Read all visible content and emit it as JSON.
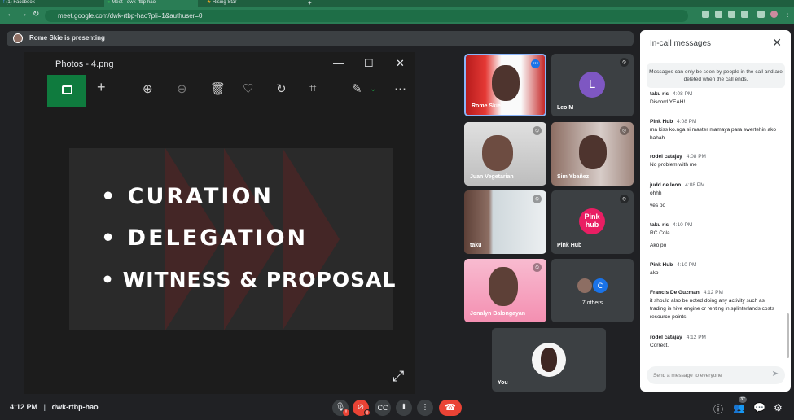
{
  "browser": {
    "tabs": [
      {
        "label": "(1) Facebook"
      },
      {
        "label": "Meet - dwk-rtbp-hao"
      },
      {
        "label": "Rising Star"
      }
    ],
    "url": "meet.google.com/dwk-rtbp-hao?pli=1&authuser=0"
  },
  "meeting": {
    "presenting_label": "Rome Skie is presenting",
    "time": "4:12 PM",
    "code": "dwk-rtbp-hao"
  },
  "photos": {
    "title": "Photos - 4.png",
    "slide_lines": [
      "• CURATION",
      "• DELEGATION",
      "• WITNESS & PROPOSAL"
    ]
  },
  "participants": [
    {
      "name": "Rome Skie",
      "muted": false
    },
    {
      "name": "Leo M",
      "initial": "L",
      "muted": true
    },
    {
      "name": "Juan Vegetarian",
      "muted": true
    },
    {
      "name": "Sim Ybañez",
      "muted": true
    },
    {
      "name": "taku",
      "muted": true
    },
    {
      "name": "Pink Hub",
      "logo_line1": "Pink",
      "logo_line2": "hub",
      "muted": true
    },
    {
      "name": "Jonalyn Balongayan",
      "muted": true
    },
    {
      "name": "7 others",
      "initial": "C"
    },
    {
      "name": "You"
    }
  ],
  "chat": {
    "title": "In-call messages",
    "notice": "Messages can only be seen by people in the call and are deleted when the call ends.",
    "messages": [
      {
        "sender": "taku ris",
        "time": "4:08 PM",
        "lines": [
          "Discord YEAH!"
        ]
      },
      {
        "sender": "Pink Hub",
        "time": "4:08 PM",
        "lines": [
          "ma kiss ko.nga si master mamaya para swertehin ako hahah"
        ]
      },
      {
        "sender": "rodel catajay",
        "time": "4:08 PM",
        "lines": [
          "No problem with me"
        ]
      },
      {
        "sender": "judd de leon",
        "time": "4:08 PM",
        "lines": [
          "ohhh",
          "yes po"
        ]
      },
      {
        "sender": "taku ris",
        "time": "4:10 PM",
        "lines": [
          "RC Cola",
          "Ako po"
        ]
      },
      {
        "sender": "Pink Hub",
        "time": "4:10 PM",
        "lines": [
          "ako"
        ]
      },
      {
        "sender": "Francis De Guzman",
        "time": "4:12 PM",
        "lines": [
          "it should also be noted doing any activity such as trading is hive engine or renting in splinterlands costs resource points."
        ]
      },
      {
        "sender": "rodel catajay",
        "time": "4:12 PM",
        "lines": [
          "Correct."
        ]
      }
    ],
    "input_placeholder": "Send a message to everyone"
  },
  "controls": {
    "participant_count": "37"
  },
  "colors": {
    "browser_green": "#2a7d55",
    "end_call_red": "#ea4335",
    "leo_avatar": "#7e57c2",
    "pinkhub": "#e91e63"
  }
}
